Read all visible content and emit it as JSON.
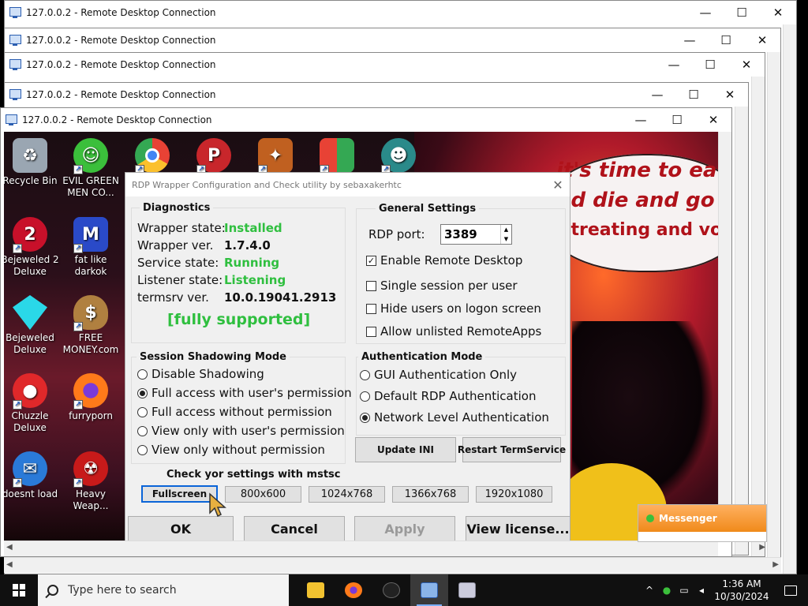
{
  "windows": [
    {
      "title": "127.0.0.2 - Remote Desktop Connection"
    },
    {
      "title": "127.0.0.2 - Remote Desktop Connection"
    },
    {
      "title": "127.0.0.2 - Remote Desktop Connection"
    },
    {
      "title": "127.0.0.2 - Remote Desktop Connection"
    },
    {
      "title": "127.0.0.2 - Remote Desktop Connection"
    }
  ],
  "window_controls": {
    "minimize": "—",
    "maximize": "☐",
    "close": "✕"
  },
  "desktop_icons": [
    {
      "label": "Recycle Bin",
      "icon": "recycle-bin-icon",
      "color": "#9aa6b2"
    },
    {
      "label": "EVIL GREEN MEN CO...",
      "icon": "people-icon",
      "color": "#3bbf3b"
    },
    {
      "label": "",
      "icon": "chrome-icon",
      "color": "#e84235"
    },
    {
      "label": "",
      "icon": "picsart-icon",
      "color": "#c8262b"
    },
    {
      "label": "",
      "icon": "app-icon",
      "color": "#c06020"
    },
    {
      "label": "",
      "icon": "windows-logo-icon",
      "color": "#2f8ad8"
    },
    {
      "label": "",
      "icon": "character-icon",
      "color": "#2a8a8a"
    },
    {
      "label": "Bejeweled 2 Deluxe",
      "icon": "bejeweled2-icon",
      "color": "#c8102a"
    },
    {
      "label": "fat like darkok",
      "icon": "mpl-icon",
      "color": "#2a4ac8"
    },
    {
      "label": "Bejeweled Deluxe",
      "icon": "diamond-icon",
      "color": "#2ad8e8"
    },
    {
      "label": "FREE MONEY.com",
      "icon": "money-bag-icon",
      "color": "#b08040"
    },
    {
      "label": "Chuzzle Deluxe",
      "icon": "chuzzle-icon",
      "color": "#e0282a"
    },
    {
      "label": "furryporn",
      "icon": "firefox-icon",
      "color": "#ff7a1a"
    },
    {
      "label": "doesnt load",
      "icon": "thunderbird-icon",
      "color": "#2a7ad8"
    },
    {
      "label": "Heavy Weap...",
      "icon": "radiation-icon",
      "color": "#c81a1a"
    }
  ],
  "wallpaper_text": [
    "it's time to eat",
    "nd die and go",
    "r treating and vo"
  ],
  "dialog": {
    "title": "RDP Wrapper Configuration and Check utility by sebaxakerhtc",
    "close": "✕",
    "diagnostics": {
      "heading": "Diagnostics",
      "rows": [
        {
          "label": "Wrapper state:",
          "value": "Installed",
          "status": true
        },
        {
          "label": "Wrapper ver.",
          "value": "1.7.4.0",
          "status": false
        },
        {
          "label": "Service state:",
          "value": "Running",
          "status": true
        },
        {
          "label": "Listener state:",
          "value": "Listening",
          "status": true
        },
        {
          "label": "termsrv ver.",
          "value": "10.0.19041.2913",
          "status": false
        }
      ],
      "support": "[fully supported]"
    },
    "general": {
      "heading": "General Settings",
      "rdp_port_label": "RDP port:",
      "rdp_port": "3389",
      "options": [
        {
          "label": "Enable Remote Desktop",
          "checked": true
        },
        {
          "label": "Single session per user",
          "checked": false
        },
        {
          "label": "Hide users on logon screen",
          "checked": false
        },
        {
          "label": "Allow unlisted RemoteApps",
          "checked": false
        }
      ]
    },
    "shadowing": {
      "heading": "Session Shadowing Mode",
      "options": [
        {
          "label": "Disable Shadowing",
          "selected": false
        },
        {
          "label": "Full access with user's permission",
          "selected": true
        },
        {
          "label": "Full access without permission",
          "selected": false
        },
        {
          "label": "View only with user's permission",
          "selected": false
        },
        {
          "label": "View only without permission",
          "selected": false
        }
      ]
    },
    "auth": {
      "heading": "Authentication Mode",
      "options": [
        {
          "label": "GUI Authentication Only",
          "selected": false
        },
        {
          "label": "Default RDP Authentication",
          "selected": false
        },
        {
          "label": "Network Level Authentication",
          "selected": true
        }
      ]
    },
    "buttons": {
      "update_ini": "Update INI",
      "restart": "Restart TermService",
      "ok": "OK",
      "cancel": "Cancel",
      "apply": "Apply",
      "license": "View license..."
    },
    "mstsc": {
      "heading": "Check yor settings with mstsc",
      "sizes": [
        "Fullscreen",
        "800x600",
        "1024x768",
        "1366x768",
        "1920x1080"
      ]
    }
  },
  "messenger": {
    "label": "Messenger"
  },
  "taskbar": {
    "search_placeholder": "Type here to search",
    "time": "1:36 AM",
    "date": "10/30/2024"
  }
}
